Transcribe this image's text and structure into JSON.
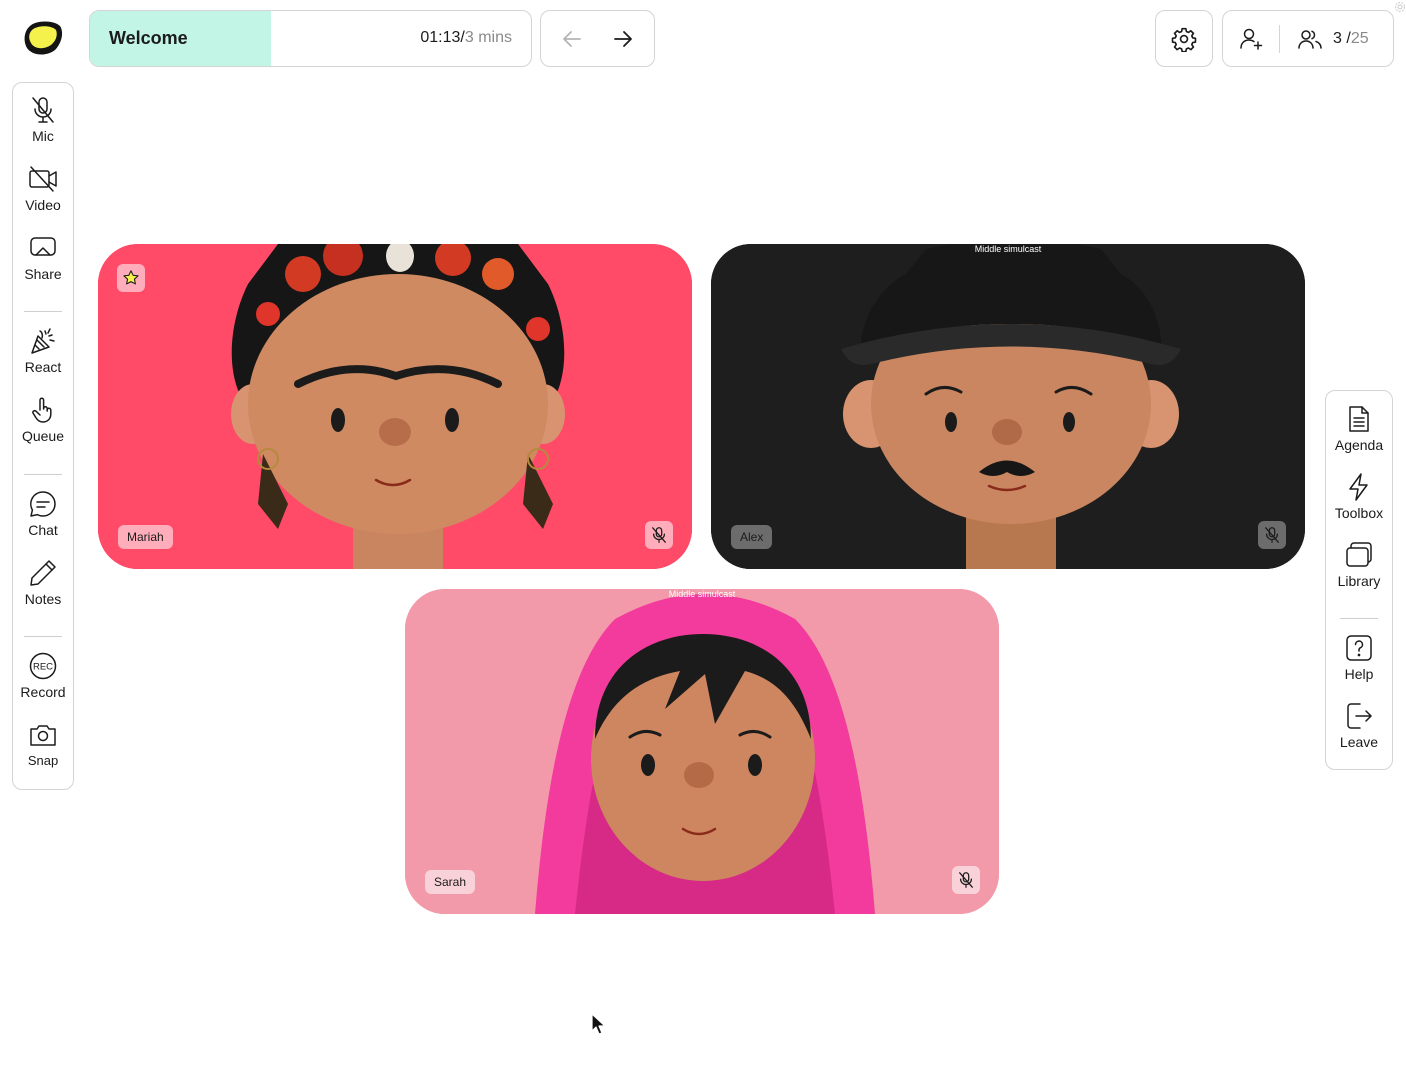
{
  "header": {
    "agenda_title": "Welcome",
    "elapsed": "01:13",
    "separator": "/",
    "total": "3 mins",
    "progress": 0.41,
    "participants_current": "3",
    "participants_separator": "/",
    "participants_max": "25"
  },
  "left_toolbar": {
    "mic": "Mic",
    "video": "Video",
    "share": "Share",
    "react": "React",
    "queue": "Queue",
    "chat": "Chat",
    "notes": "Notes",
    "record": "Record",
    "record_badge": "REC",
    "snap": "Snap"
  },
  "right_toolbar": {
    "agenda": "Agenda",
    "toolbox": "Toolbox",
    "library": "Library",
    "help": "Help",
    "leave": "Leave"
  },
  "tiles": [
    {
      "name": "Mariah",
      "simulcast": "",
      "background": "#ff4a68",
      "starred": true,
      "muted": true
    },
    {
      "name": "Alex",
      "simulcast": "Middle simulcast",
      "background": "#1e1e1e",
      "starred": false,
      "muted": true
    },
    {
      "name": "Sarah",
      "simulcast": "Middle simulcast",
      "background": "#f29aaa",
      "starred": false,
      "muted": true
    }
  ],
  "colors": {
    "accent_progress": "#c2f5e6",
    "logo_yellow": "#f4f04c",
    "border": "#d4d4d4"
  }
}
